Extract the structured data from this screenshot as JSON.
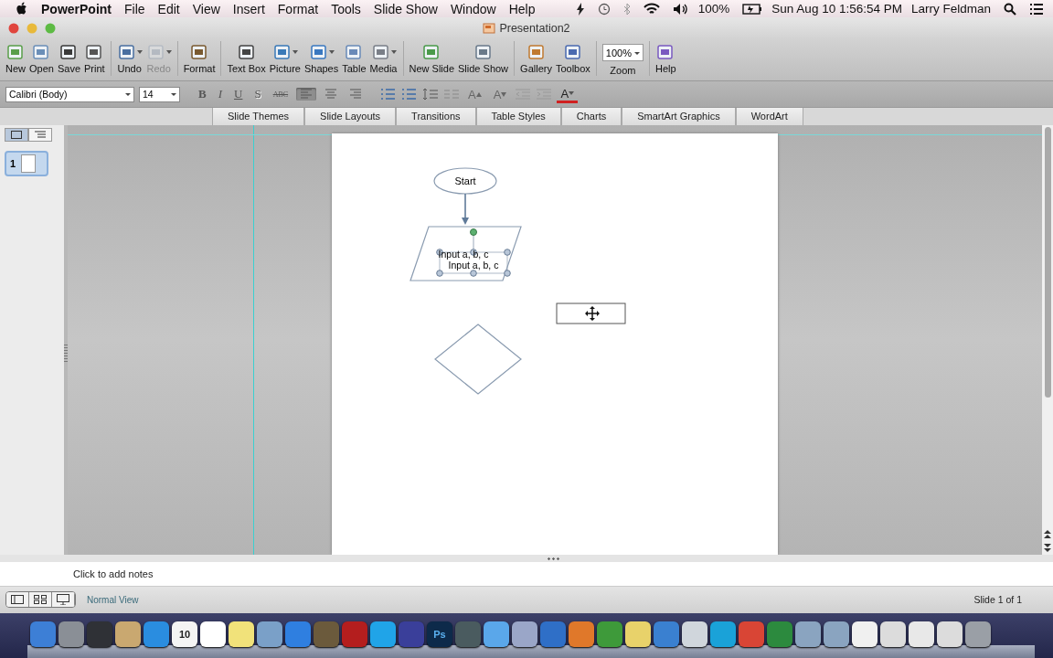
{
  "menubar": {
    "app": "PowerPoint",
    "menus": [
      "File",
      "Edit",
      "View",
      "Insert",
      "Format",
      "Tools",
      "Slide Show",
      "Window",
      "Help"
    ],
    "battery": "100%",
    "clock": "Sun Aug 10  1:56:54 PM",
    "user": "Larry Feldman"
  },
  "window": {
    "title": "Presentation2"
  },
  "toolbar": [
    {
      "label": "New",
      "disabled": false,
      "dropdown": false
    },
    {
      "label": "Open",
      "disabled": false,
      "dropdown": false
    },
    {
      "label": "Save",
      "disabled": false,
      "dropdown": false
    },
    {
      "label": "Print",
      "disabled": false,
      "dropdown": false
    },
    {
      "label": "Undo",
      "disabled": false,
      "dropdown": true
    },
    {
      "label": "Redo",
      "disabled": true,
      "dropdown": true
    },
    {
      "label": "Format",
      "disabled": false,
      "dropdown": false
    },
    {
      "label": "Text Box",
      "disabled": false,
      "dropdown": false
    },
    {
      "label": "Picture",
      "disabled": false,
      "dropdown": true
    },
    {
      "label": "Shapes",
      "disabled": false,
      "dropdown": true
    },
    {
      "label": "Table",
      "disabled": false,
      "dropdown": false
    },
    {
      "label": "Media",
      "disabled": false,
      "dropdown": true
    },
    {
      "label": "New Slide",
      "disabled": false,
      "dropdown": false
    },
    {
      "label": "Slide Show",
      "disabled": false,
      "dropdown": false
    },
    {
      "label": "Gallery",
      "disabled": false,
      "dropdown": false
    },
    {
      "label": "Toolbox",
      "disabled": false,
      "dropdown": false
    },
    {
      "label": "Zoom",
      "kind": "zoom",
      "value": "100%"
    },
    {
      "label": "Help",
      "disabled": false,
      "dropdown": false
    }
  ],
  "format_bar": {
    "font": "Calibri (Body)",
    "size": "14",
    "styles": [
      {
        "text": "B",
        "kind": "bold"
      },
      {
        "text": "I",
        "kind": "italic"
      },
      {
        "text": "U",
        "kind": "underline"
      },
      {
        "text": "S",
        "kind": "shadow"
      },
      {
        "text": "ABC",
        "kind": "strike"
      }
    ],
    "align": [
      {
        "selected": true
      },
      {
        "selected": false
      },
      {
        "selected": false
      }
    ],
    "grow": "A",
    "shrink": "A",
    "color_letter": "A"
  },
  "ribbon_tabs": [
    "Slide Themes",
    "Slide Layouts",
    "Transitions",
    "Table Styles",
    "Charts",
    "SmartArt Graphics",
    "WordArt"
  ],
  "sidebar": {
    "view_toggle": [
      {
        "selected": true
      },
      {
        "selected": false
      }
    ],
    "slides": [
      {
        "number": "1",
        "selected": true
      }
    ]
  },
  "slide": {
    "shapes": [
      {
        "kind": "terminator",
        "text": "Start"
      },
      {
        "kind": "arrow"
      },
      {
        "kind": "data",
        "texts": [
          "Input a, b, c",
          "Input a, b, c"
        ],
        "selected": true
      },
      {
        "kind": "textbox",
        "selected": true
      },
      {
        "kind": "decision"
      }
    ]
  },
  "notes": {
    "placeholder": "Click to add notes"
  },
  "status_bar": {
    "views": [
      {
        "selected": false
      },
      {
        "selected": false
      },
      {
        "selected": false
      }
    ],
    "view_name": "Normal View",
    "slide_count": "Slide 1 of 1"
  },
  "dock": [
    {
      "color": "#3d7fd6"
    },
    {
      "color": "#8a8f96"
    },
    {
      "color": "#2f3136"
    },
    {
      "color": "#c9a870"
    },
    {
      "color": "#2a8de0"
    },
    {
      "color": "#f4f4f4",
      "label": "10"
    },
    {
      "color": "#ffffff"
    },
    {
      "color": "#f1e27a"
    },
    {
      "color": "#7aa0c8"
    },
    {
      "color": "#2f7fe0"
    },
    {
      "color": "#6b5a3c"
    },
    {
      "color": "#b41e1e"
    },
    {
      "color": "#20a4e8"
    },
    {
      "color": "#3a3f9a"
    },
    {
      "color": "#0d2a4a",
      "label": "Ps"
    },
    {
      "color": "#4a5b5f"
    },
    {
      "color": "#5aa7ea"
    },
    {
      "color": "#9aa6c8"
    },
    {
      "color": "#2f6fc7"
    },
    {
      "color": "#e0782a"
    },
    {
      "color": "#3e9a3a"
    },
    {
      "color": "#e8d26a"
    },
    {
      "color": "#3a80d0"
    },
    {
      "color": "#d0d6dc"
    },
    {
      "color": "#1aa2d8"
    },
    {
      "color": "#d94535"
    },
    {
      "color": "#2c8a3e"
    },
    {
      "color": "#8aa4c0"
    },
    {
      "color": "#8aa4c0"
    },
    {
      "color": "#f0f0f0"
    },
    {
      "color": "#dcdcdc"
    },
    {
      "color": "#e8e8e8"
    },
    {
      "color": "#dcdcdc"
    },
    {
      "color": "#9a9fa6"
    }
  ]
}
